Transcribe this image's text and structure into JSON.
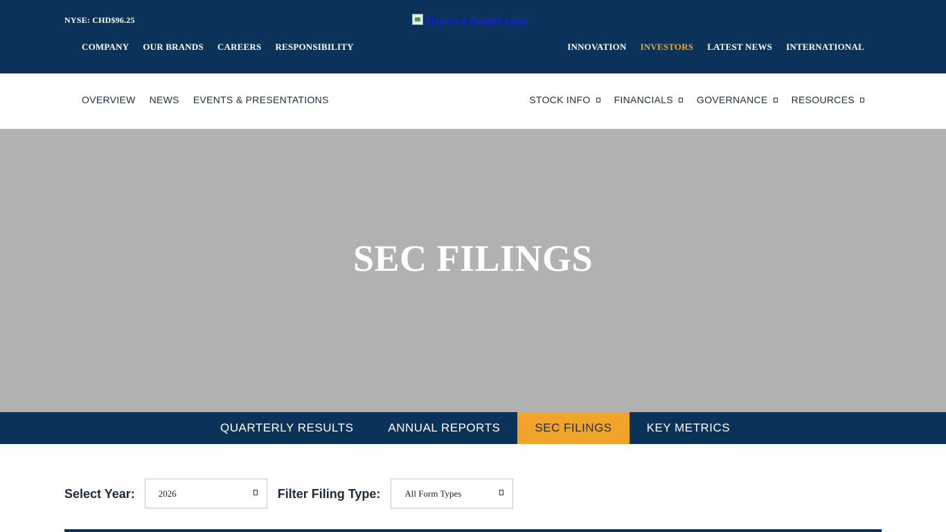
{
  "header": {
    "stock_ticker": "NYSE: CHD$96.25",
    "logo_alt": "Church & Dwight Logo",
    "nav_left": [
      {
        "label": "COMPANY"
      },
      {
        "label": "OUR BRANDS"
      },
      {
        "label": "CAREERS"
      },
      {
        "label": "RESPONSIBILITY"
      }
    ],
    "nav_right": [
      {
        "label": "INNOVATION"
      },
      {
        "label": "INVESTORS",
        "active": true
      },
      {
        "label": "LATEST NEWS"
      },
      {
        "label": "INTERNATIONAL"
      }
    ]
  },
  "sub_nav": {
    "left": [
      {
        "label": "OVERVIEW"
      },
      {
        "label": "NEWS"
      },
      {
        "label": "EVENTS & PRESENTATIONS"
      }
    ],
    "right": [
      {
        "label": "STOCK INFO"
      },
      {
        "label": "FINANCIALS"
      },
      {
        "label": "GOVERNANCE"
      },
      {
        "label": "RESOURCES"
      }
    ]
  },
  "hero": {
    "title": "SEC FILINGS"
  },
  "tabs": [
    {
      "label": "QUARTERLY RESULTS"
    },
    {
      "label": "ANNUAL REPORTS"
    },
    {
      "label": "SEC FILINGS",
      "active": true
    },
    {
      "label": "KEY METRICS"
    }
  ],
  "filters": {
    "year_label": "Select Year:",
    "year_value": "2026",
    "type_label": "Filter Filing Type:",
    "type_value": "All Form Types"
  },
  "colors": {
    "navy": "#0b3258",
    "accent": "#f0a52a",
    "hero_bg": "#b1b1b1"
  },
  "icons": {
    "dropdown": "chevron-down-icon",
    "broken_image": "broken-image-icon"
  }
}
